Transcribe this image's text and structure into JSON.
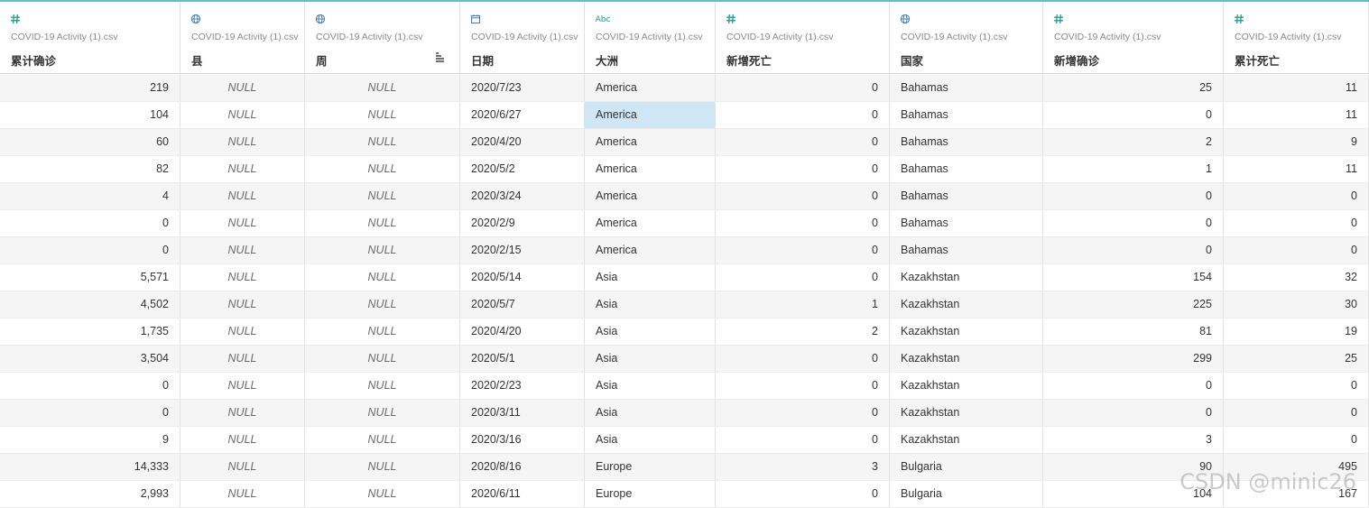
{
  "accent_color": "#1e9a8b",
  "header_line_color": "#6fb6c9",
  "columns": [
    {
      "icon": "number-icon",
      "glyph": "#",
      "source": "COVID-19 Activity (1).csv",
      "name": "累计确诊",
      "align": "num"
    },
    {
      "icon": "globe-icon",
      "glyph": "globe",
      "source": "COVID-19 Activity (1).csv",
      "name": "县",
      "align": "null"
    },
    {
      "icon": "globe-icon",
      "glyph": "globe",
      "source": "COVID-19 Activity (1).csv",
      "name": "周",
      "align": "null",
      "sorted": true
    },
    {
      "icon": "calendar-icon",
      "glyph": "cal",
      "source": "COVID-19 Activity (1).csv",
      "name": "日期",
      "align": "txt"
    },
    {
      "icon": "string-icon",
      "glyph": "Abc",
      "source": "COVID-19 Activity (1).csv",
      "name": "大洲",
      "align": "txt"
    },
    {
      "icon": "number-icon",
      "glyph": "#",
      "source": "COVID-19 Activity (1).csv",
      "name": "新增死亡",
      "align": "num"
    },
    {
      "icon": "globe-icon",
      "glyph": "globe",
      "source": "COVID-19 Activity (1).csv",
      "name": "国家",
      "align": "txt"
    },
    {
      "icon": "number-icon",
      "glyph": "#",
      "source": "COVID-19 Activity (1).csv",
      "name": "新增确诊",
      "align": "num"
    },
    {
      "icon": "number-icon",
      "glyph": "#",
      "source": "COVID-19 Activity (1).csv",
      "name": "累计死亡",
      "align": "num"
    }
  ],
  "rows": [
    [
      "219",
      "NULL",
      "NULL",
      "2020/7/23",
      "America",
      "0",
      "Bahamas",
      "25",
      "11"
    ],
    [
      "104",
      "NULL",
      "NULL",
      "2020/6/27",
      "America",
      "0",
      "Bahamas",
      "0",
      "11"
    ],
    [
      "60",
      "NULL",
      "NULL",
      "2020/4/20",
      "America",
      "0",
      "Bahamas",
      "2",
      "9"
    ],
    [
      "82",
      "NULL",
      "NULL",
      "2020/5/2",
      "America",
      "0",
      "Bahamas",
      "1",
      "11"
    ],
    [
      "4",
      "NULL",
      "NULL",
      "2020/3/24",
      "America",
      "0",
      "Bahamas",
      "0",
      "0"
    ],
    [
      "0",
      "NULL",
      "NULL",
      "2020/2/9",
      "America",
      "0",
      "Bahamas",
      "0",
      "0"
    ],
    [
      "0",
      "NULL",
      "NULL",
      "2020/2/15",
      "America",
      "0",
      "Bahamas",
      "0",
      "0"
    ],
    [
      "5,571",
      "NULL",
      "NULL",
      "2020/5/14",
      "Asia",
      "0",
      "Kazakhstan",
      "154",
      "32"
    ],
    [
      "4,502",
      "NULL",
      "NULL",
      "2020/5/7",
      "Asia",
      "1",
      "Kazakhstan",
      "225",
      "30"
    ],
    [
      "1,735",
      "NULL",
      "NULL",
      "2020/4/20",
      "Asia",
      "2",
      "Kazakhstan",
      "81",
      "19"
    ],
    [
      "3,504",
      "NULL",
      "NULL",
      "2020/5/1",
      "Asia",
      "0",
      "Kazakhstan",
      "299",
      "25"
    ],
    [
      "0",
      "NULL",
      "NULL",
      "2020/2/23",
      "Asia",
      "0",
      "Kazakhstan",
      "0",
      "0"
    ],
    [
      "0",
      "NULL",
      "NULL",
      "2020/3/11",
      "Asia",
      "0",
      "Kazakhstan",
      "0",
      "0"
    ],
    [
      "9",
      "NULL",
      "NULL",
      "2020/3/16",
      "Asia",
      "0",
      "Kazakhstan",
      "3",
      "0"
    ],
    [
      "14,333",
      "NULL",
      "NULL",
      "2020/8/16",
      "Europe",
      "3",
      "Bulgaria",
      "90",
      "495"
    ],
    [
      "2,993",
      "NULL",
      "NULL",
      "2020/6/11",
      "Europe",
      "0",
      "Bulgaria",
      "104",
      "167"
    ]
  ],
  "selected_cell": {
    "row": 1,
    "col": 4
  },
  "watermark": "CSDN @minic26"
}
